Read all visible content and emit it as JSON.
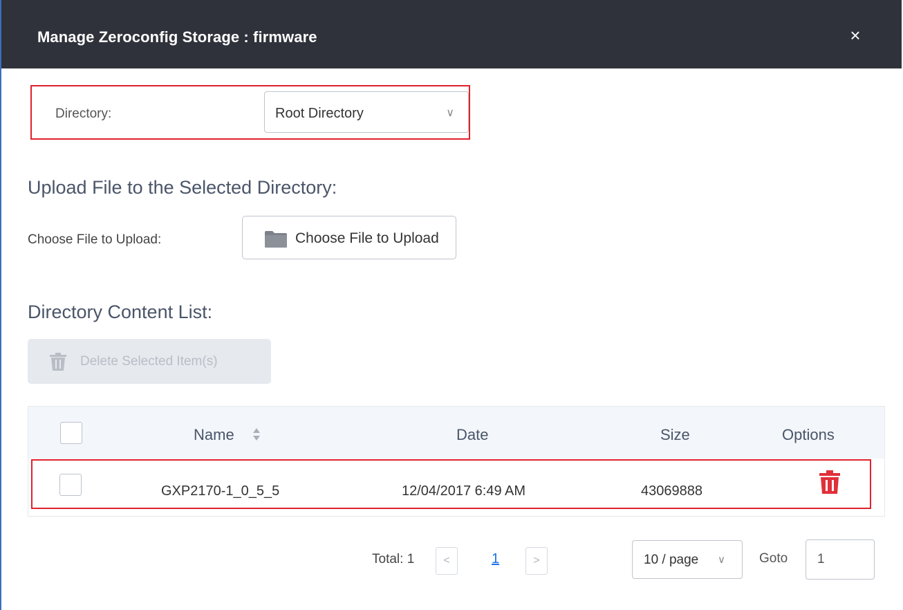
{
  "dialog": {
    "title": "Manage Zeroconfig Storage : firmware",
    "close_icon": "×"
  },
  "directory": {
    "label": "Directory:",
    "selected": "Root Directory",
    "chevron": "∨"
  },
  "upload": {
    "heading": "Upload File to the Selected Directory:",
    "label": "Choose File to Upload:",
    "button_label": "Choose File to Upload"
  },
  "content_list": {
    "heading": "Directory Content List:",
    "delete_button": "Delete Selected Item(s)",
    "columns": [
      "Name",
      "Date",
      "Size",
      "Options"
    ],
    "rows": [
      {
        "name": "GXP2170-1_0_5_5",
        "date": "12/04/2017 6:49 AM",
        "size": "43069888"
      }
    ]
  },
  "pagination": {
    "total": "Total: 1",
    "prev": "<",
    "current_page": "1",
    "next": ">",
    "per_page": "10 / page",
    "per_page_chevron": "∨",
    "goto_label": "Goto",
    "goto_value": "1"
  },
  "colors": {
    "header_bg": "#2f323a",
    "highlight_border": "#e0212c",
    "delete_icon": "#e0303a",
    "link": "#1a73e8"
  }
}
